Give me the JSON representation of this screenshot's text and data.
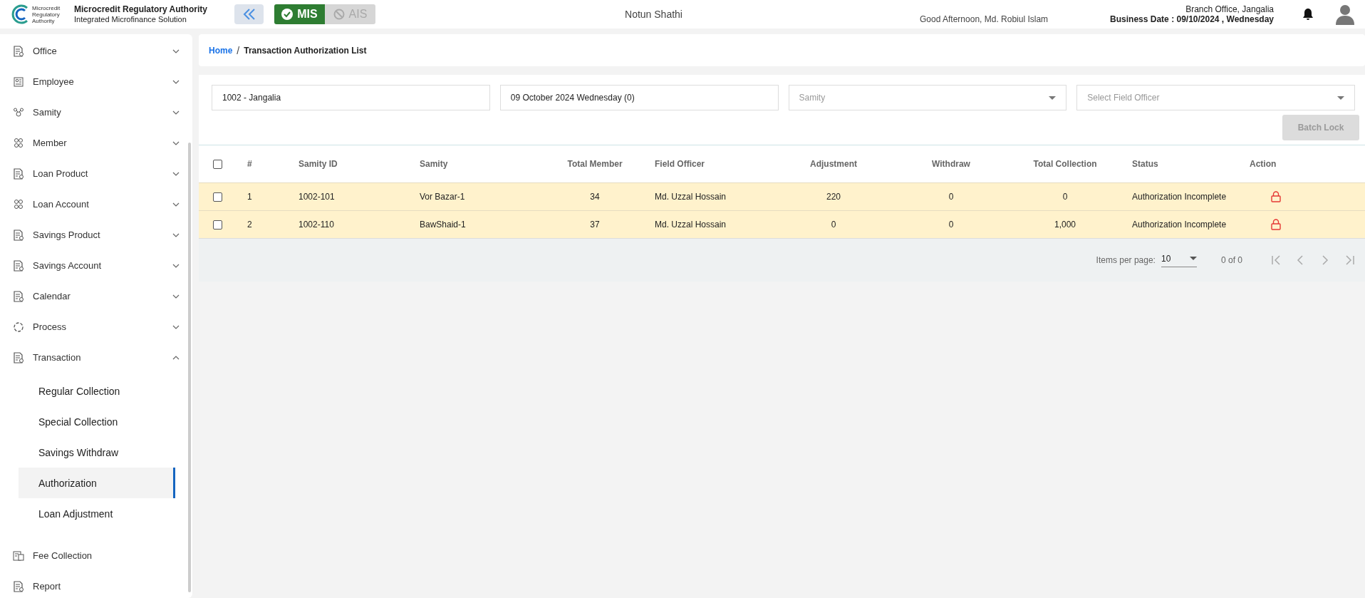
{
  "header": {
    "logo_text": "Microcredit Regulatory Authority",
    "org_name": "Microcredit Regulatory Authority",
    "org_subtitle": "Integrated Microfinance Solution",
    "modules": [
      {
        "label": "MIS",
        "selected": true
      },
      {
        "label": "AIS",
        "selected": false
      }
    ],
    "app_name": "Notun Shathi",
    "branch": "Branch Office, Jangalia",
    "greeting": "Good Afternoon, Md. Robiul Islam",
    "business_date": "Business Date : 09/10/2024 , Wednesday"
  },
  "sidebar": {
    "items": [
      {
        "label": "Office",
        "expanded": false
      },
      {
        "label": "Employee",
        "expanded": false
      },
      {
        "label": "Samity",
        "expanded": false
      },
      {
        "label": "Member",
        "expanded": false
      },
      {
        "label": "Loan Product",
        "expanded": false
      },
      {
        "label": "Loan Account",
        "expanded": false
      },
      {
        "label": "Savings Product",
        "expanded": false
      },
      {
        "label": "Savings Account",
        "expanded": false
      },
      {
        "label": "Calendar",
        "expanded": false
      },
      {
        "label": "Process",
        "expanded": false
      },
      {
        "label": "Transaction",
        "expanded": true,
        "children": [
          {
            "label": "Regular Collection",
            "selected": false
          },
          {
            "label": "Special Collection",
            "selected": false
          },
          {
            "label": "Savings Withdraw",
            "selected": false
          },
          {
            "label": "Authorization",
            "selected": true
          },
          {
            "label": "Loan Adjustment",
            "selected": false
          }
        ]
      },
      {
        "label": "Fee Collection"
      },
      {
        "label": "Report"
      }
    ]
  },
  "breadcrumb": [
    "Home",
    "Transaction Authorization List"
  ],
  "breadcrumb_separator": "/",
  "filters": {
    "branch": {
      "value": "1002 - Jangalia"
    },
    "date": {
      "value": "09 October 2024 Wednesday (0)"
    },
    "samity": {
      "placeholder": "Samity"
    },
    "field_officer": {
      "placeholder": "Select Field Officer"
    },
    "batch_lock": {
      "label": "Batch Lock",
      "disabled": true
    }
  },
  "table": {
    "columns": [
      "#",
      "Samity ID",
      "Samity",
      "Total Member",
      "Field Officer",
      "Adjustment",
      "Withdraw",
      "Total Collection",
      "Status",
      "Action"
    ],
    "all_checked": false,
    "rows": [
      {
        "checked": false,
        "cells": [
          "1",
          "1002-101",
          "Vor Bazar-1",
          "34",
          "Md. Uzzal Hossain",
          "220",
          "0",
          "0",
          "Authorization Incomplete"
        ]
      },
      {
        "checked": false,
        "cells": [
          "2",
          "1002-110",
          "BawShaid-1",
          "37",
          "Md. Uzzal Hossain",
          "0",
          "0",
          "1,000",
          "Authorization Incomplete"
        ]
      }
    ]
  },
  "paginator": {
    "label": "Items per page:",
    "page_size": "10",
    "range": "0 of 0"
  }
}
